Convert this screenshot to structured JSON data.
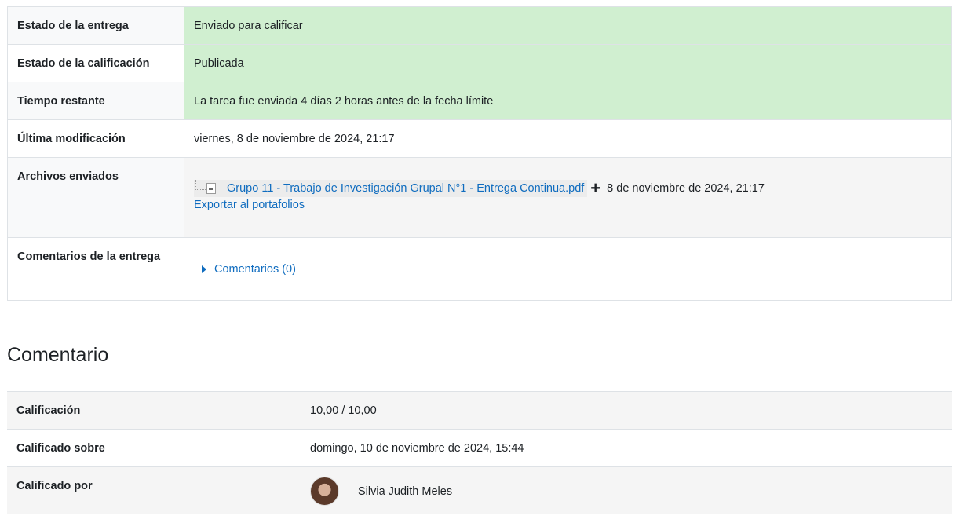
{
  "submission": {
    "rows": [
      {
        "label": "Estado de la entrega",
        "value": "Enviado para calificar"
      },
      {
        "label": "Estado de la calificación",
        "value": "Publicada"
      },
      {
        "label": "Tiempo restante",
        "value": "La tarea fue enviada 4 días 2 horas antes de la fecha límite"
      },
      {
        "label": "Última modificación",
        "value": "viernes, 8 de noviembre de 2024, 21:17"
      },
      {
        "label": "Archivos enviados",
        "file_name": "Grupo 11 - Trabajo de Investigación Grupal N°1 - Entrega Continua.pdf",
        "file_date": "8 de noviembre de 2024, 21:17",
        "export_label": "Exportar al portafolios"
      },
      {
        "label": "Comentarios de la entrega",
        "comments_link": "Comentarios (0)"
      }
    ]
  },
  "feedback": {
    "title": "Comentario",
    "rows": [
      {
        "label": "Calificación",
        "value": "10,00 / 10,00"
      },
      {
        "label": "Calificado sobre",
        "value": "domingo, 10 de noviembre de 2024, 15:44"
      },
      {
        "label": "Calificado por",
        "value": "Silvia Judith Meles"
      }
    ]
  },
  "colors": {
    "status_green": "#d0efd0",
    "link": "#0f6cbf"
  },
  "icons": {
    "file": "pdf-icon",
    "add": "plus-icon",
    "expand": "caret-right-icon",
    "user": "avatar"
  }
}
